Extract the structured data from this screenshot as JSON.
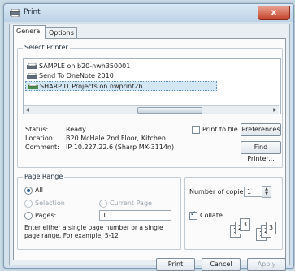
{
  "window": {
    "title": "Print",
    "close": "x"
  },
  "tabs": {
    "general": "General",
    "options": "Options"
  },
  "select_printer": {
    "label": "Select Printer",
    "printers": [
      {
        "name": "SAMPLE on b20-nwh350001"
      },
      {
        "name": "Send To OneNote 2010"
      },
      {
        "name": "SHARP IT Projects on nwprint2b"
      }
    ],
    "selected": "SHARP IT Projects on nwprint2b"
  },
  "status": {
    "label": "Status:",
    "value": "Ready"
  },
  "location": {
    "label": "Location:",
    "value": "B20 McHale 2nd Floor, Kitchen"
  },
  "comment": {
    "label": "Comment:",
    "value": "IP 10.227.22.6 (Sharp MX-3114n)"
  },
  "print_to_file": "Print to file",
  "preferences_button": "Preferences",
  "find_printer_button": "Find Printer...",
  "page_range": {
    "label": "Page Range",
    "all": "All",
    "selection": "Selection",
    "current_page": "Current Page",
    "pages": "Pages:",
    "pages_value": "1",
    "help_line1": "Enter either a single page number or a single",
    "help_line2": "page range.  For example, 5-12"
  },
  "copies": {
    "label": "Number of copies:",
    "value": "1",
    "collate": "Collate"
  },
  "collate_pages": [
    "1",
    "2",
    "3"
  ],
  "buttons": {
    "print": "Print",
    "cancel": "Cancel",
    "apply": "Apply"
  },
  "colors": {
    "accent": "#2a5f8f",
    "background": "#c9dbe6"
  },
  "icons": [
    "printer-icon",
    "close-icon",
    "spin-up-icon",
    "spin-down-icon"
  ]
}
